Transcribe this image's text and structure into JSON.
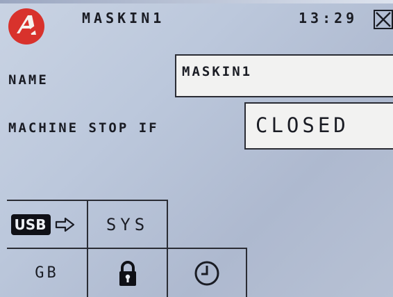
{
  "header": {
    "title": "MASKIN1",
    "time": "13:29",
    "logo_icon": "red-circle-logo",
    "close_icon": "close-x-icon"
  },
  "form": {
    "name_label": "NAME",
    "name_value": "MASKIN1",
    "stop_label": "MACHINE STOP IF",
    "stop_value": "CLOSED"
  },
  "buttons": {
    "usb_label": "USB",
    "usb_arrow_icon": "arrow-right-icon",
    "sys_label": "SYS",
    "gb_label": "GB",
    "lock_icon": "padlock-icon",
    "clock_icon": "clock-icon"
  },
  "colors": {
    "logo_red": "#d8322c",
    "field_bg": "#f2f2f1",
    "screen_bg": "#bcc8dc"
  }
}
